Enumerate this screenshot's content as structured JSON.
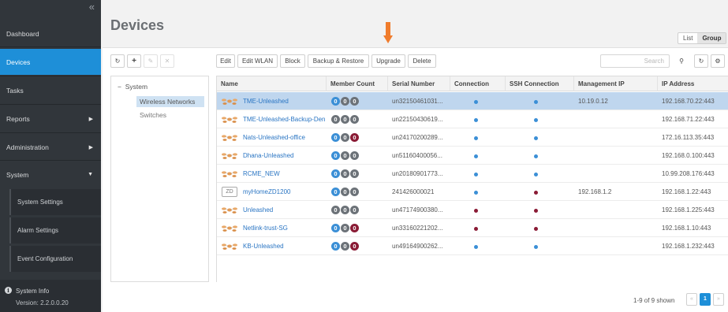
{
  "sidebar": {
    "collapse_glyph": "«",
    "items": [
      {
        "label": "Dashboard"
      },
      {
        "label": "Devices"
      },
      {
        "label": "Tasks"
      },
      {
        "label": "Reports"
      },
      {
        "label": "Administration"
      },
      {
        "label": "System"
      }
    ],
    "system_sub": [
      {
        "label": "System Settings"
      },
      {
        "label": "Alarm Settings"
      },
      {
        "label": "Event Configuration"
      }
    ],
    "system_info": {
      "label": "System Info",
      "version": "Version: 2.2.0.0.20"
    }
  },
  "header": {
    "title": "Devices",
    "view_toggle": {
      "list": "List",
      "group": "Group",
      "selected": "Group"
    }
  },
  "left_toolbar": {
    "refresh_icon": "↻",
    "add_icon": "+",
    "edit_icon": "✎",
    "delete_icon": "✕"
  },
  "toolbar": {
    "edit": "Edit",
    "edit_wlan": "Edit WLAN",
    "block": "Block",
    "backup_restore": "Backup & Restore",
    "upgrade": "Upgrade",
    "delete": "Delete",
    "search_placeholder": "Search",
    "search_icon": "⚲",
    "refresh_icon": "↻",
    "settings_icon": "⚙"
  },
  "tree": {
    "root": "System",
    "root_toggle": "−",
    "children": [
      {
        "label": "Wireless Networks"
      },
      {
        "label": "Switches"
      }
    ]
  },
  "table": {
    "columns": [
      "Name",
      "Member Count",
      "Serial Number",
      "Connection",
      "SSH Connection",
      "Management IP",
      "IP Address"
    ],
    "rows": [
      {
        "icon": "ap",
        "name": "TME-Unleashed",
        "members": [
          "b",
          "g",
          "g"
        ],
        "serial": "un32150461031...",
        "connection": "blue",
        "ssh": "blue",
        "mgmt_ip": "10.19.0.12",
        "ip": "192.168.70.22:443",
        "selected": true
      },
      {
        "icon": "ap",
        "name": "TME-Unleashed-Backup-Den",
        "members": [
          "g",
          "g",
          "g"
        ],
        "serial": "un22150430619...",
        "connection": "blue",
        "ssh": "blue",
        "mgmt_ip": "",
        "ip": "192.168.71.22:443",
        "selected": false
      },
      {
        "icon": "ap",
        "name": "Nats-Unleashed-office",
        "members": [
          "b",
          "g",
          "r"
        ],
        "serial": "un24170200289...",
        "connection": "blue",
        "ssh": "blue",
        "mgmt_ip": "",
        "ip": "172.16.113.35:443",
        "selected": false
      },
      {
        "icon": "ap",
        "name": "Dhana-Unleashed",
        "members": [
          "b",
          "g",
          "g"
        ],
        "serial": "un51160400056...",
        "connection": "blue",
        "ssh": "blue",
        "mgmt_ip": "",
        "ip": "192.168.0.100:443",
        "selected": false
      },
      {
        "icon": "ap",
        "name": "RCME_NEW",
        "members": [
          "b",
          "g",
          "g"
        ],
        "serial": "un20180901773...",
        "connection": "blue",
        "ssh": "blue",
        "mgmt_ip": "",
        "ip": "10.99.208.176:443",
        "selected": false
      },
      {
        "icon": "zd",
        "zd_label": "ZD",
        "name": "myHomeZD1200",
        "members": [
          "b",
          "g",
          "g"
        ],
        "serial": "241426000021",
        "connection": "blue",
        "ssh": "red",
        "mgmt_ip": "192.168.1.2",
        "ip": "192.168.1.22:443",
        "selected": false
      },
      {
        "icon": "ap",
        "name": "Unleashed",
        "members": [
          "g",
          "g",
          "g"
        ],
        "serial": "un47174900380...",
        "connection": "red",
        "ssh": "red",
        "mgmt_ip": "",
        "ip": "192.168.1.225:443",
        "selected": false
      },
      {
        "icon": "ap",
        "name": "Netlink-trust-SG",
        "members": [
          "b",
          "g",
          "r"
        ],
        "serial": "un33160221202...",
        "connection": "red",
        "ssh": "red",
        "mgmt_ip": "",
        "ip": "192.168.1.10:443",
        "selected": false
      },
      {
        "icon": "ap",
        "name": "KB-Unleashed",
        "members": [
          "b",
          "g",
          "r"
        ],
        "serial": "un49164900262...",
        "connection": "blue",
        "ssh": "blue",
        "mgmt_ip": "",
        "ip": "192.168.1.232:443",
        "selected": false
      }
    ]
  },
  "member_badge_digit": "0",
  "pager": {
    "info": "1-9 of 9 shown",
    "current_page": "1",
    "prev_glyph": "«",
    "next_glyph": "»"
  },
  "colors": {
    "accent": "#1e8fd8",
    "status_blue": "#3b8fd6",
    "status_red": "#8a1b35",
    "annotation_arrow": "#f07c2c"
  }
}
